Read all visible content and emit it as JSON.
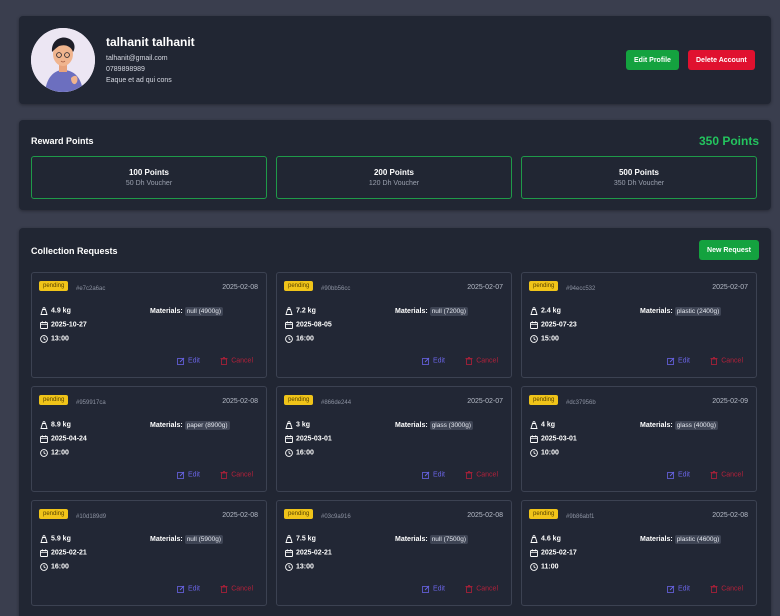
{
  "profile": {
    "name": "talhanit talhanit",
    "email": "talhanit@gmail.com",
    "phone": "0789898989",
    "bio": "Eaque et ad qui cons",
    "edit_label": "Edit Profile",
    "delete_label": "Delete Account"
  },
  "rewards": {
    "title": "Reward Points",
    "total": "350 Points",
    "options": [
      {
        "points": "100 Points",
        "voucher": "50 Dh Voucher"
      },
      {
        "points": "200 Points",
        "voucher": "120 Dh Voucher"
      },
      {
        "points": "500 Points",
        "voucher": "350 Dh Voucher"
      }
    ]
  },
  "requests": {
    "title": "Collection Requests",
    "new_label": "New Request",
    "materials_label": "Materials:",
    "edit_label": "Edit",
    "cancel_label": "Cancel",
    "items": [
      {
        "status": "pending",
        "id": "#e7c2a6ac",
        "created": "2025-02-08",
        "weight": "4.9 kg",
        "date": "2025-10-27",
        "time": "13:00",
        "materials": "null (4900g)"
      },
      {
        "status": "pending",
        "id": "#90bb56cc",
        "created": "2025-02-07",
        "weight": "7.2 kg",
        "date": "2025-08-05",
        "time": "16:00",
        "materials": "null (7200g)"
      },
      {
        "status": "pending",
        "id": "#94ecc532",
        "created": "2025-02-07",
        "weight": "2.4 kg",
        "date": "2025-07-23",
        "time": "15:00",
        "materials": "plastic (2400g)"
      },
      {
        "status": "pending",
        "id": "#959917ca",
        "created": "2025-02-08",
        "weight": "8.9 kg",
        "date": "2025-04-24",
        "time": "12:00",
        "materials": "paper (8900g)"
      },
      {
        "status": "pending",
        "id": "#866de244",
        "created": "2025-02-07",
        "weight": "3 kg",
        "date": "2025-03-01",
        "time": "16:00",
        "materials": "glass (3000g)"
      },
      {
        "status": "pending",
        "id": "#dc37956b",
        "created": "2025-02-09",
        "weight": "4 kg",
        "date": "2025-03-01",
        "time": "10:00",
        "materials": "glass (4000g)"
      },
      {
        "status": "pending",
        "id": "#10d189d9",
        "created": "2025-02-08",
        "weight": "5.9 kg",
        "date": "2025-02-21",
        "time": "16:00",
        "materials": "null (5900g)"
      },
      {
        "status": "pending",
        "id": "#03c9a916",
        "created": "2025-02-08",
        "weight": "7.5 kg",
        "date": "2025-02-21",
        "time": "13:00",
        "materials": "null (7500g)"
      },
      {
        "status": "pending",
        "id": "#9b86abf1",
        "created": "2025-02-08",
        "weight": "4.6 kg",
        "date": "2025-02-17",
        "time": "11:00",
        "materials": "plastic (4600g)"
      }
    ]
  },
  "colors": {
    "background": "#3a3e4e",
    "panel": "#212633",
    "accent_green": "#14a23f",
    "danger_red": "#e0112f",
    "points_green": "#23c45e",
    "pending_yellow": "#f0c419",
    "edit_purple": "#6a64e6"
  }
}
